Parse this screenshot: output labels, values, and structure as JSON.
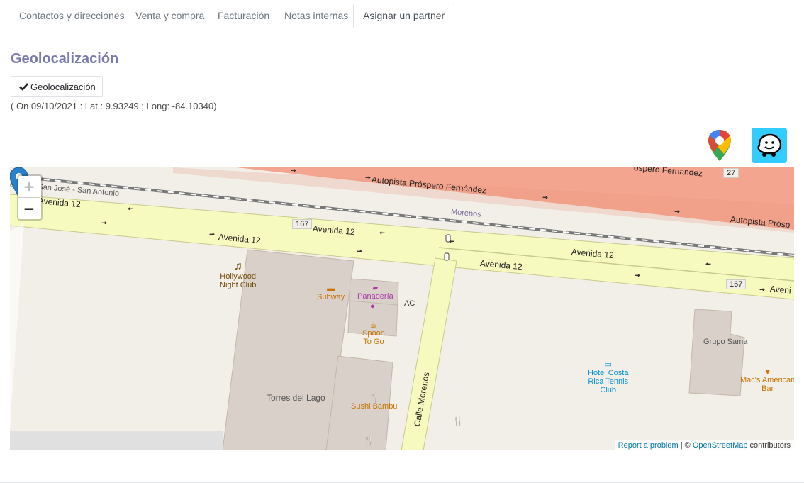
{
  "tabs": [
    {
      "label": "Contactos y direcciones",
      "active": false
    },
    {
      "label": "Venta y compra",
      "active": false
    },
    {
      "label": "Facturación",
      "active": false
    },
    {
      "label": "Notas internas",
      "active": false
    },
    {
      "label": "Asignar un partner",
      "active": true
    }
  ],
  "section": {
    "title": "Geolocalización",
    "button_label": "Geolocalización",
    "button_icon": "check-icon",
    "info": "( On 09/10/2021 : Lat : 9.93249 ;  Long: -84.10340)"
  },
  "apps": {
    "google_maps_icon": "google-maps-icon",
    "waze_icon": "waze-icon",
    "waze_color": "#33ccff"
  },
  "map": {
    "zoom_in": "+",
    "zoom_out": "−",
    "roads": {
      "autopista_1": "Autopista Próspero Fernández",
      "autopista_2": "Autopista Prósp",
      "autopista_3": "ospero Fernandez",
      "shield_27": "27",
      "rail": "en... o | San José - San Antonio",
      "morenos": "Morenos",
      "avenida_a": "Avenida 12",
      "avenida_b": "Avenida 12",
      "avenida_c": "Avenida 12",
      "avenida_d": "Avenida 12",
      "avenida_e": "Avenida 12",
      "avenida_f": "Aveni",
      "shield_167a": "167",
      "shield_167b": "167",
      "calle": "Calle Morenos"
    },
    "pois": {
      "hollywood": "Hollywood\nNight Club",
      "subway": "Subway",
      "panaderia": "Panadería",
      "ac": "AC",
      "spoon": "Spoon\nTo Go",
      "torres": "Torres\ndel Lago",
      "sushi": "Sushi Bambu",
      "hotel": "Hotel Costa\nRica Tennis\nClub",
      "grupo": "Grupo\nSama",
      "macs": "Mac's American\nBar"
    },
    "attribution": {
      "report": "Report a problem",
      "sep": " | © ",
      "osm": "OpenStreetMap",
      "contrib": " contributors"
    },
    "colors": {
      "background": "#f2efe9",
      "motorway": "#f4a58f",
      "avenue": "#f7fabf",
      "building": "#d9d0c9",
      "poi_food": "#c77400",
      "poi_shop": "#ac39ac",
      "poi_hotel": "#0092da",
      "marker": "#2a81cb"
    }
  }
}
